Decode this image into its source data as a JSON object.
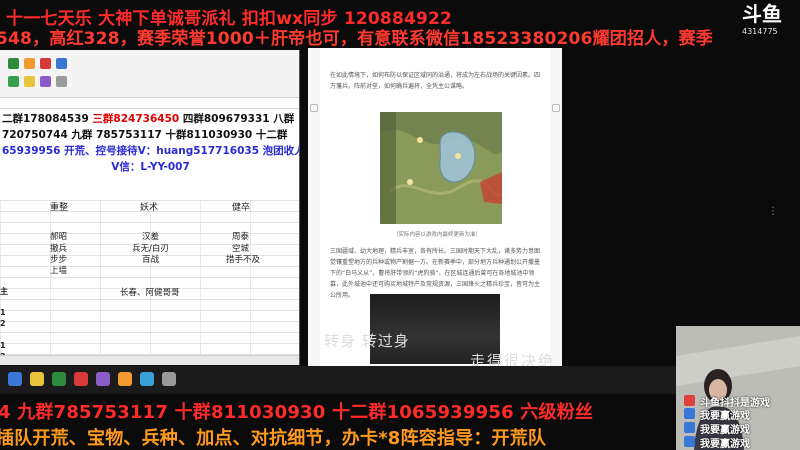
{
  "banners": {
    "line1": "十一七天乐 大神下单诚哥派礼 扣扣wx同步 120884922",
    "line2": "548，高红328，赛季荣誉1000＋肝帝也可，有意联系微信18523380206耀团招人，赛季",
    "line3": "4 九群785753117   十群811030930 十二群1065939956 六级粉丝",
    "line4": "插队开荒、宝物、兵种、加点、对抗细节，办卡*8阵容指导：开荒队"
  },
  "platform": {
    "logo": "斗鱼",
    "room_id": "4314775"
  },
  "spreadsheet": {
    "qq_line1": {
      "a": "二群178084539 ",
      "b": "三群824736450",
      "c": " 四群809679331  八群"
    },
    "qq_line2": {
      "a": "720750744    九群 785753117 十群811030930 十二群"
    },
    "qq_line3": "65939956  开荒、控号接待V：huang517716035 泡团收人",
    "qq_line4": "V信：L-YY-007",
    "headers": [
      "重整",
      "妖术",
      "健卒"
    ],
    "rows": [
      [
        "郝昭",
        "汉羞",
        "周泰"
      ],
      [
        "撤兵",
        "兵无/白刃",
        "空城"
      ],
      [
        "步步",
        "百战",
        "措手不及"
      ],
      [
        "上墙",
        "",
        ""
      ]
    ],
    "extra_cell": "长春、阿健哥哥",
    "row_labels": [
      "主",
      "",
      "1",
      "2",
      "",
      "1",
      "2",
      "",
      ""
    ]
  },
  "document": {
    "para1": "在如此情境下，如何布防以保证区域同的治通，将成为左右战场的关键因素。四万藩兵，阵前对垒，如何确兵遍将，全凭主公谋略。",
    "caption": "（实际内容以游戏内最终更新为准）",
    "para2": "三国疆域、幼大地理，精兵丰室，各有所长。三国时期天下大乱，诸多势力意图觉镶重塑地方的兵种或物产割据一方。在新赛季中，部分地方兵种通划公开撒墨下的“白马义从”，曹将肝带领的“虎豹骑”，在区城连通后曾可在各地城池中领募，此外城池中还可购买地城特产及常规资源，三国烽火之精兵珍宝，皆可为主公所用。"
  },
  "subtitles": {
    "line1": "转身  转过身",
    "line2": "走得很决绝"
  },
  "chat": [
    "斗鱼抖抖是游戏",
    "我要赢游戏",
    "我要赢游戏",
    "我要赢游戏"
  ]
}
